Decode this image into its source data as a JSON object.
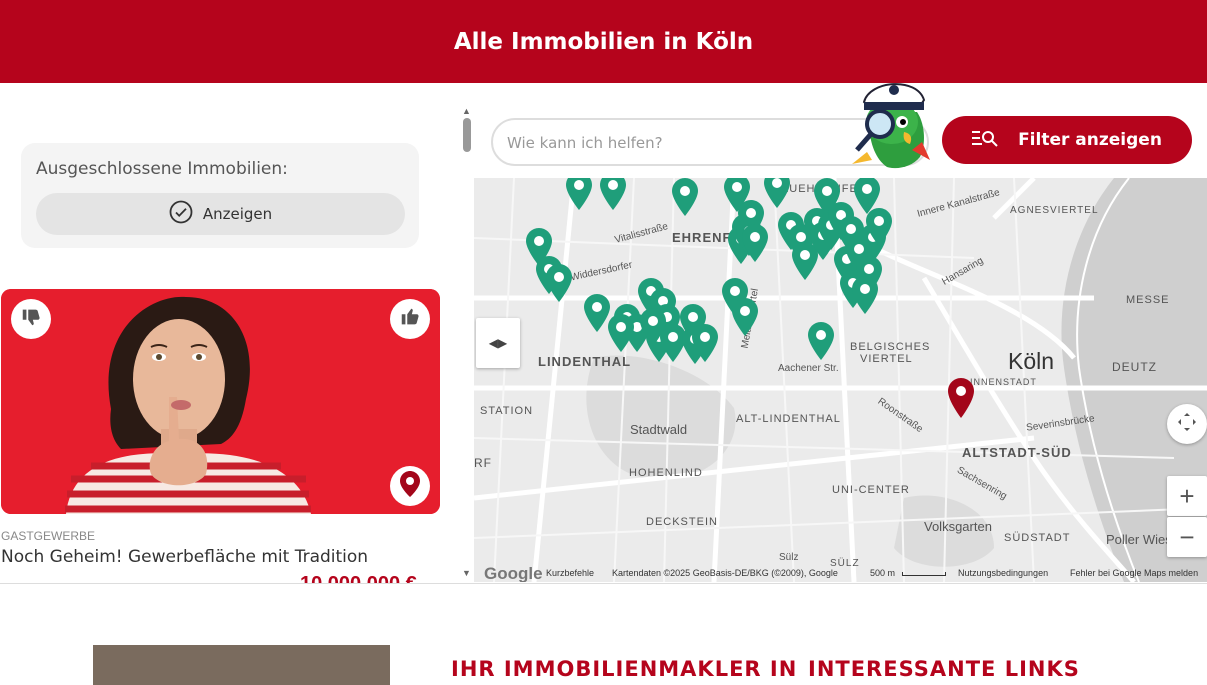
{
  "header": {
    "title": "Alle Immobilien in Köln"
  },
  "excluded": {
    "label": "Ausgeschlossene Immobilien:",
    "button": "Anzeigen"
  },
  "listing": {
    "category": "GASTGEWERBE",
    "title": "Noch Geheim! Gewerbefläche mit Tradition",
    "price": "10.000.000 €"
  },
  "search": {
    "placeholder": "Wie kann ich helfen?"
  },
  "filter": {
    "label": "Filter anzeigen"
  },
  "map": {
    "labels": {
      "ehrenfeld": "EHRENFELD",
      "lindenthal": "LINDENTHAL",
      "belgisches": "BELGISCHES",
      "viertel": "VIERTEL",
      "koeln": "Köln",
      "deutz": "DEUTZ",
      "messe": "MESSE",
      "agnesviertel": "AGNESVIERTEL",
      "altlindenthal": "ALT-LINDENTHAL",
      "altstadtsued": "ALTSTADT-SÜD",
      "stadtwald": "Stadtwald",
      "hohenlind": "HOHENLIND",
      "unicenter": "UNI-CENTER",
      "deckstein": "DECKSTEIN",
      "volksgarten": "Volksgarten",
      "suedstadt": "SÜDSTADT",
      "station": "STATION",
      "aachener": "Aachener Str.",
      "pollerwiesen": "Poller Wiesen",
      "neuehrenfeld": "NEUEHRENFELD",
      "innenstadt": "INNENSTADT",
      "rf": "RF",
      "inner_kanal": "Innere Kanalstraße",
      "hansaring": "Hansaring",
      "roonstr": "Roonstraße",
      "severinsbr": "Severinsbrücke",
      "sachsenring": "Sachsenring",
      "suelz1": "Sülz",
      "suelz2": "SÜLZ",
      "vitalis": "Vitalisstraße",
      "widdersdorfer": "Widdersdorfer",
      "melaten": "Melatengürtel"
    },
    "footer": {
      "google": "Google",
      "shortcuts": "Kurzbefehle",
      "data": "Kartendaten ©2025 GeoBasis-DE/BKG (©2009), Google",
      "scale": "500 m",
      "terms": "Nutzungsbedingungen",
      "report": "Fehler bei Google Maps melden"
    },
    "colors": {
      "pin_listing": "#1f9e7a",
      "pin_selected": "#a3061a",
      "accent": "#b5041c"
    }
  },
  "footer_section": {
    "heading1": "IHR IMMOBILIENMAKLER IN",
    "heading2": "INTERESSANTE LINKS"
  }
}
